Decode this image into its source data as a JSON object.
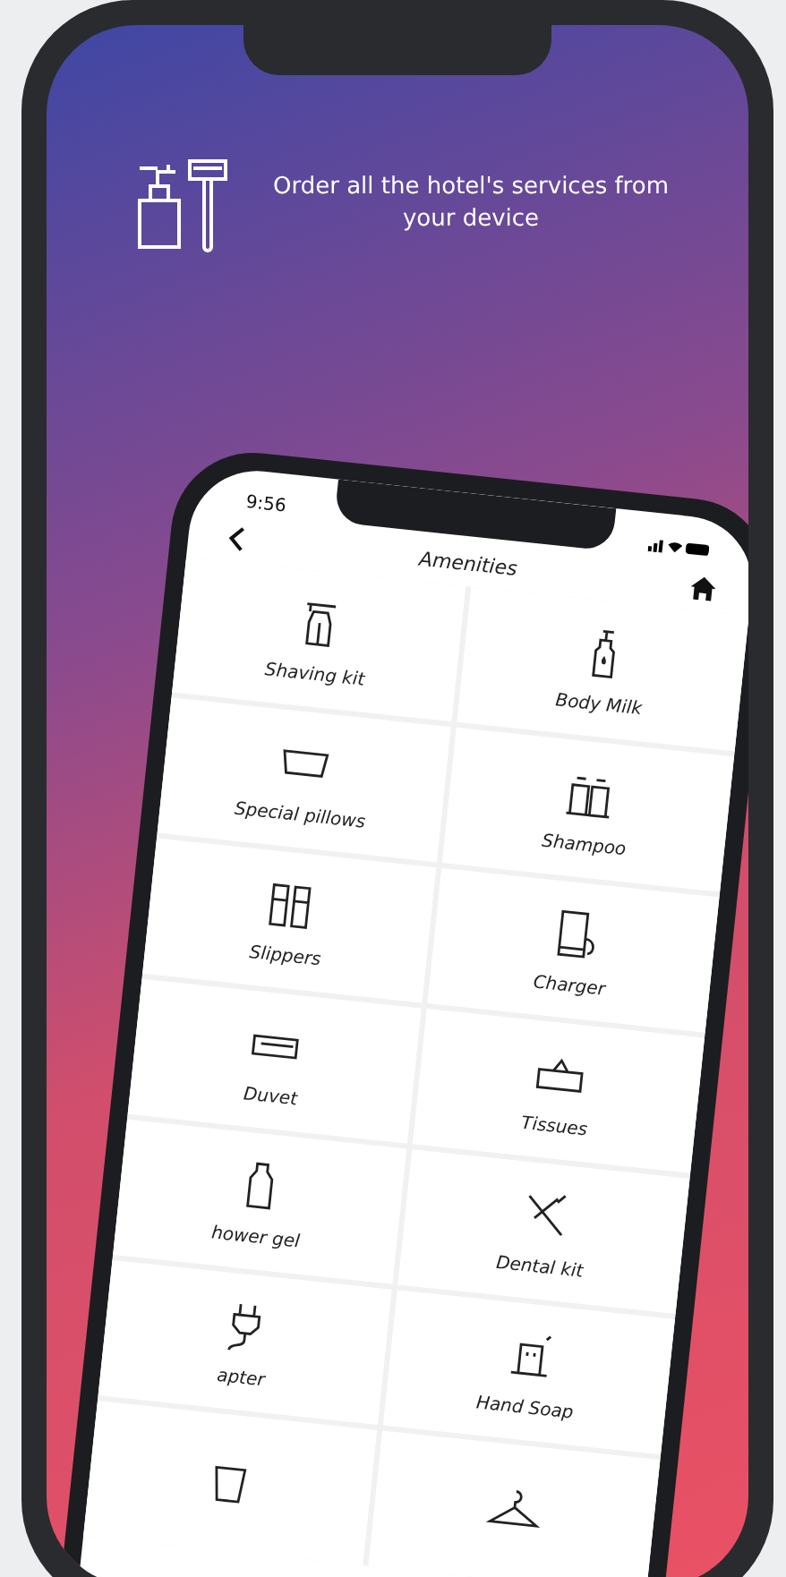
{
  "promo": {
    "text": "Order all the hotel's services from your device"
  },
  "app": {
    "time": "9:56",
    "title": "Amenities",
    "items": [
      {
        "label": "Shaving kit"
      },
      {
        "label": "Body Milk"
      },
      {
        "label": "Special pillows"
      },
      {
        "label": "Shampoo"
      },
      {
        "label": "Slippers"
      },
      {
        "label": "Charger"
      },
      {
        "label": "Duvet"
      },
      {
        "label": "Tissues"
      },
      {
        "label": "hower gel"
      },
      {
        "label": "Dental kit"
      },
      {
        "label": "apter"
      },
      {
        "label": "Hand Soap"
      }
    ]
  }
}
